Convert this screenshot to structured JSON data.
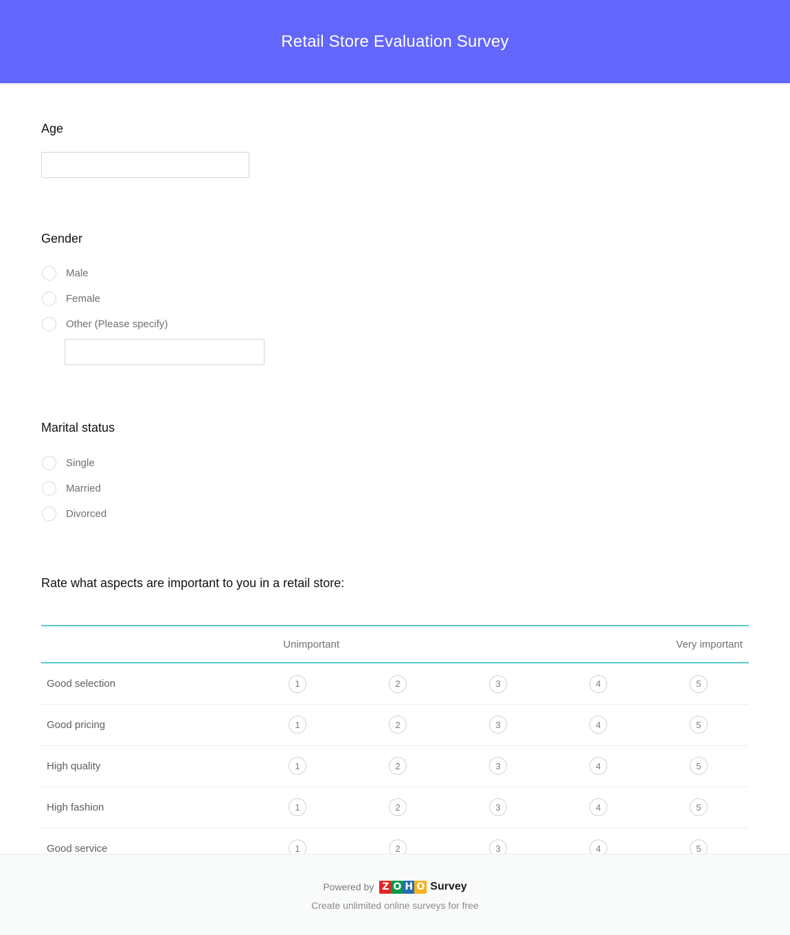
{
  "header": {
    "title": "Retail Store Evaluation Survey",
    "background_color": "#6366fb",
    "text_color": "#ffffff"
  },
  "questions": {
    "age": {
      "title": "Age",
      "input_value": "",
      "input_placeholder": ""
    },
    "gender": {
      "title": "Gender",
      "options": [
        {
          "label": "Male"
        },
        {
          "label": "Female"
        },
        {
          "label": "Other (Please specify)"
        }
      ],
      "other_input_value": "",
      "other_input_placeholder": ""
    },
    "marital_status": {
      "title": "Marital status",
      "options": [
        {
          "label": "Single"
        },
        {
          "label": "Married"
        },
        {
          "label": "Divorced"
        }
      ]
    },
    "matrix": {
      "title": "Rate what aspects are important to you in a retail store:",
      "scale_low_label": "Unimportant",
      "scale_high_label": "Very important",
      "accent_color": "#5ec8c8",
      "scale_values": [
        "1",
        "2",
        "3",
        "4",
        "5"
      ],
      "rows": [
        {
          "label": "Good selection",
          "values": [
            "1",
            "2",
            "3",
            "4",
            "5"
          ]
        },
        {
          "label": "Good pricing",
          "values": [
            "1",
            "2",
            "3",
            "4",
            "5"
          ]
        },
        {
          "label": "High quality",
          "values": [
            "1",
            "2",
            "3",
            "4",
            "5"
          ]
        },
        {
          "label": "High fashion",
          "values": [
            "1",
            "2",
            "3",
            "4",
            "5"
          ]
        },
        {
          "label": "Good service",
          "values": [
            "1",
            "2",
            "3",
            "4",
            "5"
          ]
        }
      ]
    }
  },
  "footer": {
    "powered_by": "Powered by",
    "brand_tiles": [
      "Z",
      "O",
      "H",
      "O"
    ],
    "brand_word": "Survey",
    "tagline": "Create unlimited online surveys for free",
    "background_color": "#f9fafa"
  }
}
